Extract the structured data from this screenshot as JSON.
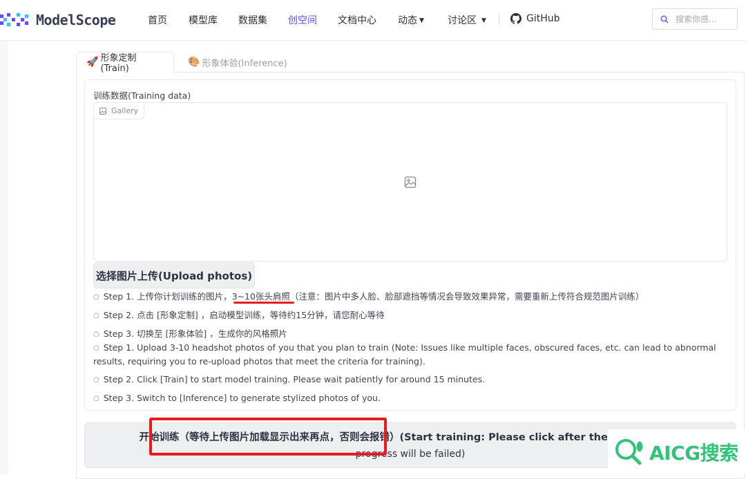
{
  "nav": {
    "logo_text": "ModelScope",
    "items": [
      {
        "label": "首页"
      },
      {
        "label": "模型库"
      },
      {
        "label": "数据集"
      },
      {
        "label": "创空间"
      },
      {
        "label": "文档中心"
      },
      {
        "label": "动态"
      },
      {
        "label": "讨论区"
      }
    ],
    "active_item": "创空间",
    "github_label": "GitHub",
    "search_placeholder": "搜索你感...",
    "accent_color": "#624aff"
  },
  "tabs": [
    {
      "icon": "rocket-icon",
      "label": "形象定制(Train)",
      "active": true
    },
    {
      "icon": "painting-icon",
      "label": "形象体验(Inference)",
      "active": false
    }
  ],
  "training": {
    "label": "训练数据(Training data)",
    "gallery_tag": "Gallery",
    "upload_button": "选择图片上传(Upload photos)",
    "steps": [
      {
        "pre": "Step 1. 上传你计划训练的图片，",
        "highlight": "3~10张头肩照",
        "post": "（注意：图片中多人脸、脸部遮挡等情况会导致效果异常，需要重新上传符合规范图片训练）"
      },
      {
        "text": "Step 2. 点击 [形象定制] ，启动模型训练，等待约15分钟，请您耐心等待"
      },
      {
        "text": "Step 3. 切换至 [形象体验] ，生成你的风格照片"
      },
      {
        "text": "Step 1. Upload 3-10 headshot photos of you that you plan to train (Note: Issues like multiple faces, obscured faces, etc. can lead to abnormal results, requiring you to re-upload photos that meet the criteria for training)."
      },
      {
        "text": "Step 2. Click [Train] to start model training. Please wait patiently for around 15 minutes."
      },
      {
        "text": "Step 3. Switch to [Inference] to generate stylized photos of you."
      }
    ],
    "train_button_line1_cn": "开始训练（等待上传图片加载显示出来再点，否则会报错）",
    "train_button_line1_en": "(Start training: Please click after the photos are s",
    "train_button_line2_en": "progress will be failed)",
    "annotation_color": "#e81c1c"
  },
  "watermark": {
    "text": "AICG搜索",
    "color": "#34c27a"
  }
}
